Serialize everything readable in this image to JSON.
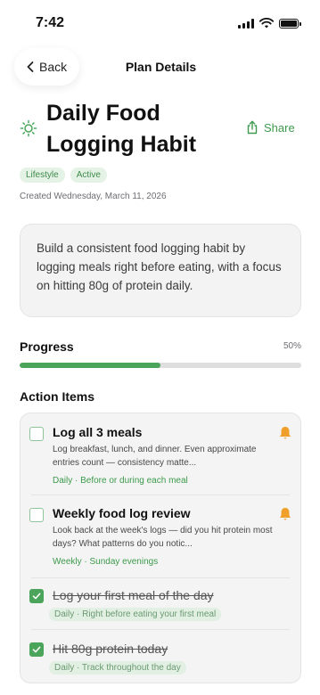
{
  "status": {
    "time": "7:42"
  },
  "nav": {
    "back_label": "Back",
    "title": "Plan Details"
  },
  "plan": {
    "title_line1": "Daily Food",
    "title_line2": "Logging Habit",
    "share_label": "Share",
    "tags": [
      "Lifestyle",
      "Active"
    ],
    "created": "Created Wednesday, March 11, 2026",
    "description": "Build a consistent food logging habit by logging meals right before eating, with a focus on hitting 80g of protein daily."
  },
  "progress": {
    "label": "Progress",
    "percent_text": "50%",
    "value": 0.5
  },
  "actions": {
    "title": "Action Items",
    "items": [
      {
        "title": "Log all 3 meals",
        "desc": "Log breakfast, lunch, and dinner. Even approximate entries count — consistency matte...",
        "meta": "Daily · Before or during each meal",
        "done": false,
        "reminder": true
      },
      {
        "title": "Weekly food log review",
        "desc": "Look back at the week's logs — did you hit protein most days? What patterns do you notic...",
        "meta": "Weekly · Sunday evenings",
        "done": false,
        "reminder": true
      },
      {
        "title": "Log your first meal of the day",
        "desc": "",
        "meta": "Daily · Right before eating your first meal",
        "done": true,
        "reminder": false
      },
      {
        "title": "Hit 80g protein today",
        "desc": "",
        "meta": "Daily · Track throughout the day",
        "done": true,
        "reminder": false
      }
    ]
  },
  "colors": {
    "accent": "#4aa45a",
    "bell": "#f0a02a",
    "tag_bg": "#e5f3e7"
  }
}
